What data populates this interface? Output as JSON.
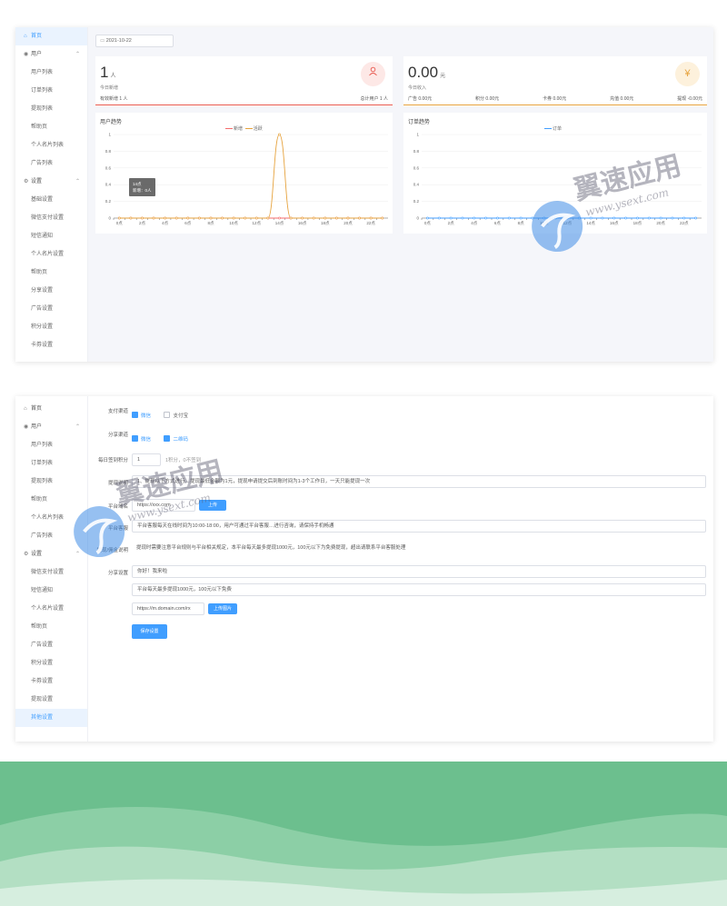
{
  "sidebar": {
    "home": "首页",
    "user_group": "用户",
    "user_items": [
      "用户列表",
      "订单列表",
      "提现列表",
      "帮助页",
      "个人名片列表",
      "广告列表"
    ],
    "settings_group": "设置",
    "settings_items": [
      "基础设置",
      "微信支付设置",
      "短信通知",
      "个人名片设置",
      "帮助页",
      "分享设置",
      "广告设置",
      "积分设置",
      "卡券设置",
      "提现设置",
      "其他设置"
    ]
  },
  "dashboard": {
    "date": "2021-10-22",
    "users_card": {
      "count": "1",
      "unit": "人",
      "label": "今日新增",
      "foot_left": "有效新增 1 人",
      "foot_right": "总计用户 1 人",
      "icon": "user-icon",
      "icon_color": "#e8594f",
      "accent": "#e8594f"
    },
    "income_card": {
      "amount": "0.00",
      "unit": "元",
      "label": "今日收入",
      "foot": [
        "广告 0.00元",
        "积分 0.00元",
        "卡券 0.00元",
        "充值 0.00元",
        "提现 -0.00元"
      ],
      "icon": "yen-icon",
      "icon_glyph": "¥",
      "icon_color": "#e6a23c",
      "accent": "#e6a23c"
    },
    "users_chart_title": "用户趋势",
    "orders_chart_title": "订单趋势",
    "tooltip": [
      "14点",
      "新增：0人"
    ]
  },
  "chart_data": [
    {
      "type": "line",
      "title": "用户趋势",
      "x": [
        "0点",
        "1点",
        "2点",
        "3点",
        "4点",
        "5点",
        "6点",
        "7点",
        "8点",
        "9点",
        "10点",
        "11点",
        "12点",
        "13点",
        "14点",
        "15点",
        "16点",
        "17点",
        "18点",
        "19点",
        "20点",
        "21点",
        "22点",
        "23点"
      ],
      "x_tick_labels": [
        "0点",
        "2点",
        "4点",
        "6点",
        "8点",
        "10点",
        "12点",
        "14点",
        "16点",
        "18点",
        "20点",
        "22点"
      ],
      "series": [
        {
          "name": "新增",
          "color": "#f56c6c",
          "values": [
            0,
            0,
            0,
            0,
            0,
            0,
            0,
            0,
            0,
            0,
            0,
            0,
            0,
            0,
            0,
            0,
            0,
            0,
            0,
            0,
            0,
            0,
            0,
            0
          ]
        },
        {
          "name": "活跃",
          "color": "#e6a23c",
          "values": [
            0,
            0,
            0,
            0,
            0,
            0,
            0,
            0,
            0,
            0,
            0,
            0,
            0,
            0,
            1,
            0,
            0,
            0,
            0,
            0,
            0,
            0,
            0,
            0
          ]
        }
      ],
      "ylim": [
        0,
        1
      ],
      "y_ticks": [
        "0",
        "0.2",
        "0.4",
        "0.6",
        "0.8",
        "1"
      ],
      "grid": true,
      "legend": "top-center"
    },
    {
      "type": "line",
      "title": "订单趋势",
      "x": [
        "0点",
        "1点",
        "2点",
        "3点",
        "4点",
        "5点",
        "6点",
        "7点",
        "8点",
        "9点",
        "10点",
        "11点",
        "12点",
        "13点",
        "14点",
        "15点",
        "16点",
        "17点",
        "18点",
        "19点",
        "20点",
        "21点",
        "22点",
        "23点"
      ],
      "x_tick_labels": [
        "0点",
        "2点",
        "4点",
        "6点",
        "8点",
        "10点",
        "12点",
        "14点",
        "16点",
        "18点",
        "20点",
        "22点"
      ],
      "series": [
        {
          "name": "订单",
          "color": "#409eff",
          "values": [
            0,
            0,
            0,
            0,
            0,
            0,
            0,
            0,
            0,
            0,
            0,
            0,
            0,
            0,
            0,
            0,
            0,
            0,
            0,
            0,
            0,
            0,
            0,
            0
          ]
        }
      ],
      "ylim": [
        0,
        1
      ],
      "y_ticks": [
        "0",
        "0.2",
        "0.4",
        "0.6",
        "0.8",
        "1"
      ],
      "grid": true,
      "legend": "top-center"
    }
  ],
  "settings_form": {
    "active_menu": "其他设置",
    "row_pay": {
      "label": "支付渠道",
      "options": [
        {
          "text": "微信",
          "checked": true
        },
        {
          "text": "支付宝",
          "checked": false
        }
      ]
    },
    "row_share": {
      "label": "分享渠道",
      "options": [
        {
          "text": "微信",
          "checked": true
        },
        {
          "text": "二维码",
          "checked": true
        }
      ]
    },
    "row_limit": {
      "label": "每日签到积分",
      "value": "1",
      "hint": "1积分，0不签到"
    },
    "row_notice": {
      "label": "提现说明",
      "value": "1、提现以下方式进行…提现最低金额为1元，提现申请提交后到账时间为1-3个工作日，一天只能提现一次"
    },
    "row_domain": {
      "label": "平台域名",
      "value": "https://xxx.com",
      "button": "上传"
    },
    "row_service": {
      "label": "平台客服",
      "value": "平台客服每天在线时间为10:00-18:00，用户可通过平台客服…进行咨询，请保持手机畅通"
    },
    "row_tip": {
      "label": "提现/佣金说明",
      "value": "提现时需要注意平台规则与平台相关规定，本平台每天最多提现1000元，100元以下为免费提现，超出请联系平台客服处理"
    },
    "row_share_copy": {
      "label": "分享设置",
      "title_value": "你好！我来啦",
      "desc_value": "平台每天最多提现1000元，100元以下免费",
      "url_value": "https://m.domain.com/rx",
      "button": "上传图片"
    },
    "submit": "保存设置"
  },
  "watermark": {
    "text": "翼速应用",
    "url": "www.ysext.com"
  }
}
